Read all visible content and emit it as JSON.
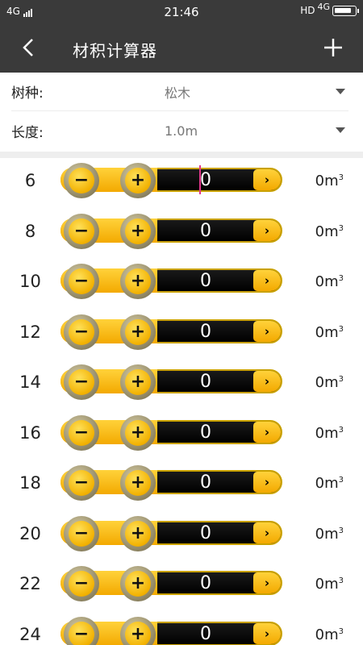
{
  "status": {
    "network": "4G",
    "time": "21:46",
    "hd": "HD",
    "network_right": "4G"
  },
  "appbar": {
    "title": "材积计算器"
  },
  "form": {
    "species_label": "树种:",
    "species_value": "松木",
    "length_label": "长度:",
    "length_value": "1.0m"
  },
  "rows": [
    {
      "size": "6",
      "qty": "0",
      "volume": "0m",
      "unit_sup": "3"
    },
    {
      "size": "8",
      "qty": "0",
      "volume": "0m",
      "unit_sup": "3"
    },
    {
      "size": "10",
      "qty": "0",
      "volume": "0m",
      "unit_sup": "3"
    },
    {
      "size": "12",
      "qty": "0",
      "volume": "0m",
      "unit_sup": "3"
    },
    {
      "size": "14",
      "qty": "0",
      "volume": "0m",
      "unit_sup": "3"
    },
    {
      "size": "16",
      "qty": "0",
      "volume": "0m",
      "unit_sup": "3"
    },
    {
      "size": "18",
      "qty": "0",
      "volume": "0m",
      "unit_sup": "3"
    },
    {
      "size": "20",
      "qty": "0",
      "volume": "0m",
      "unit_sup": "3"
    },
    {
      "size": "22",
      "qty": "0",
      "volume": "0m",
      "unit_sup": "3"
    },
    {
      "size": "24",
      "qty": "0",
      "volume": "0m",
      "unit_sup": "3"
    }
  ],
  "glyphs": {
    "minus": "−",
    "plus": "+",
    "next": "›"
  }
}
